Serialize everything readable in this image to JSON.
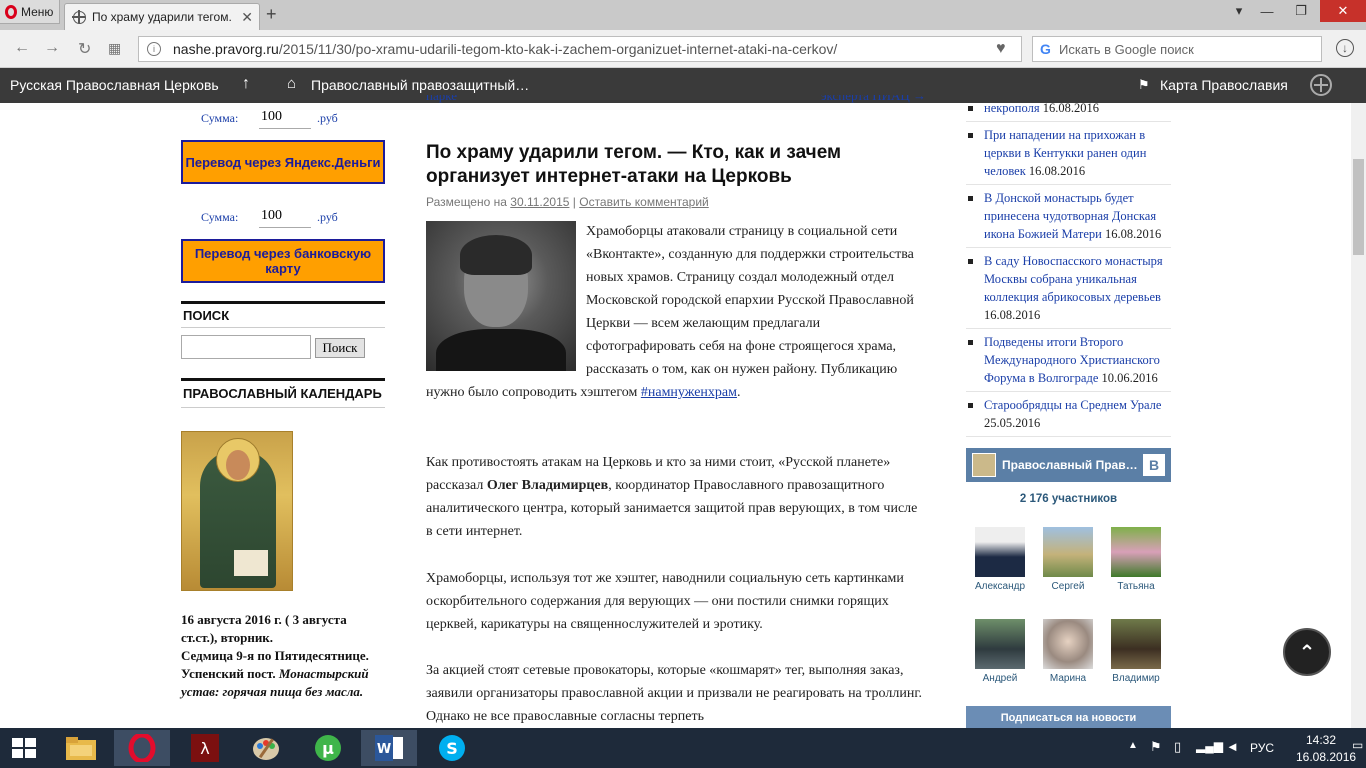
{
  "browser": {
    "menu_label": "Меню",
    "tab_title": "По храму ударили тегом.",
    "new_tab": "+",
    "tab_menu": "▾",
    "min": "—",
    "max": "❐",
    "close": "✕",
    "url_domain": "nashe.pravorg.ru",
    "url_path": "/2015/11/30/po-xramu-udarili-tegom-kto-kak-i-zachem-organizuet-internet-ataki-na-cerkov/",
    "search_placeholder": "Искать в Google поиск"
  },
  "site_nav": {
    "item1": "Русская Православная Церковь",
    "up_arrow": "↑",
    "item2": "Православный правозащитный…",
    "item3": "Карта Православия"
  },
  "left": {
    "sum_label": "Сумма:",
    "sum_value": "100",
    "currency": ".руб",
    "pay_yandex": "Перевод через Яндекс.Деньги",
    "pay_bank": "Перевод через банковскую карту",
    "search_title": "ПОИСК",
    "search_btn": "Поиск",
    "calendar_title": "ПРАВОСЛАВНЫЙ КАЛЕНДАРЬ",
    "cal_line1": "16 августа 2016 г. ( 3 августа ст.ст.), вторник.",
    "cal_line2": "Седмица 9-я по Пятидесятнице. Успенский пост.",
    "cal_line3": "Монастырский устав: горячая пища без масла."
  },
  "main": {
    "prev": "парке",
    "next": "эксперта ПИАЦ →",
    "title": "По храму ударили тегом. — Кто, как и зачем организует интернет-атаки на Церковь",
    "meta_prefix": "Размещено на",
    "meta_date": "30.11.2015",
    "meta_sep": " | ",
    "meta_comment": "Оставить комментарий",
    "p1": "Храмоборцы атаковали страницу в социальной сети «Вконтакте», созданную для поддержки строительства новых храмов. Страницу создал молодежный отдел Московской городской епархии Русской Православной Церкви — всем желающим предлагали сфотографировать себя на фоне строящегося храма, рассказать о том, как он нужен району. Публикацию нужно было сопроводить хэштегом",
    "p1_link": "#намнуженхрам",
    "p1_end": ".",
    "p2_start": "Как противостоять атакам на Церковь и кто за ними стоит, «Русской планете» рассказал",
    "p2_name": "Олег Владимирцев",
    "p2_end": ", координатор Православного правозащитного аналитического центра, который занимается защитой прав верующих, в том числе в сети интернет.",
    "p3": "Храмоборцы, используя тот же хэштег, наводнили социальную сеть картинками оскорбительного содержания для верующих — они постили снимки горящих церквей, карикатуры на священнослужителей и эротику.",
    "p4": "За акцией стоят сетевые провокаторы, которые «кошмарят» тег, выполняя заказ, заявили организаторы православной акции и призвали не реагировать на троллинг. Однако не все православные согласны терпеть"
  },
  "right": {
    "news": [
      {
        "title": "некрополя",
        "date": "16.08.2016"
      },
      {
        "title": "При нападении на прихожан в церкви в Кентукки ранен один человек",
        "date": "16.08.2016"
      },
      {
        "title": "В Донской монастырь будет принесена чудотворная Донская икона Божией Матери",
        "date": "16.08.2016"
      },
      {
        "title": "В саду Новоспасского монастыря Москвы собрана уникальная коллекция абрикосовых деревьев",
        "date": "16.08.2016"
      },
      {
        "title": "Подведены итоги Второго Международного Христианского Форума в Волгограде",
        "date": "10.06.2016"
      },
      {
        "title": "Старообрядцы на Среднем Урале",
        "date": "25.05.2016"
      }
    ],
    "vk_group": "Православный Прав…",
    "vk_logo": "В",
    "vk_count": "2 176 участников",
    "members": [
      "Александр",
      "Сергей",
      "Татьяна",
      "Андрей",
      "Марина",
      "Владимир"
    ],
    "vk_subscribe": "Подписаться на новости"
  },
  "totop": "⌃",
  "taskbar": {
    "lang": "РУС",
    "time": "14:32",
    "date": "16.08.2016"
  }
}
